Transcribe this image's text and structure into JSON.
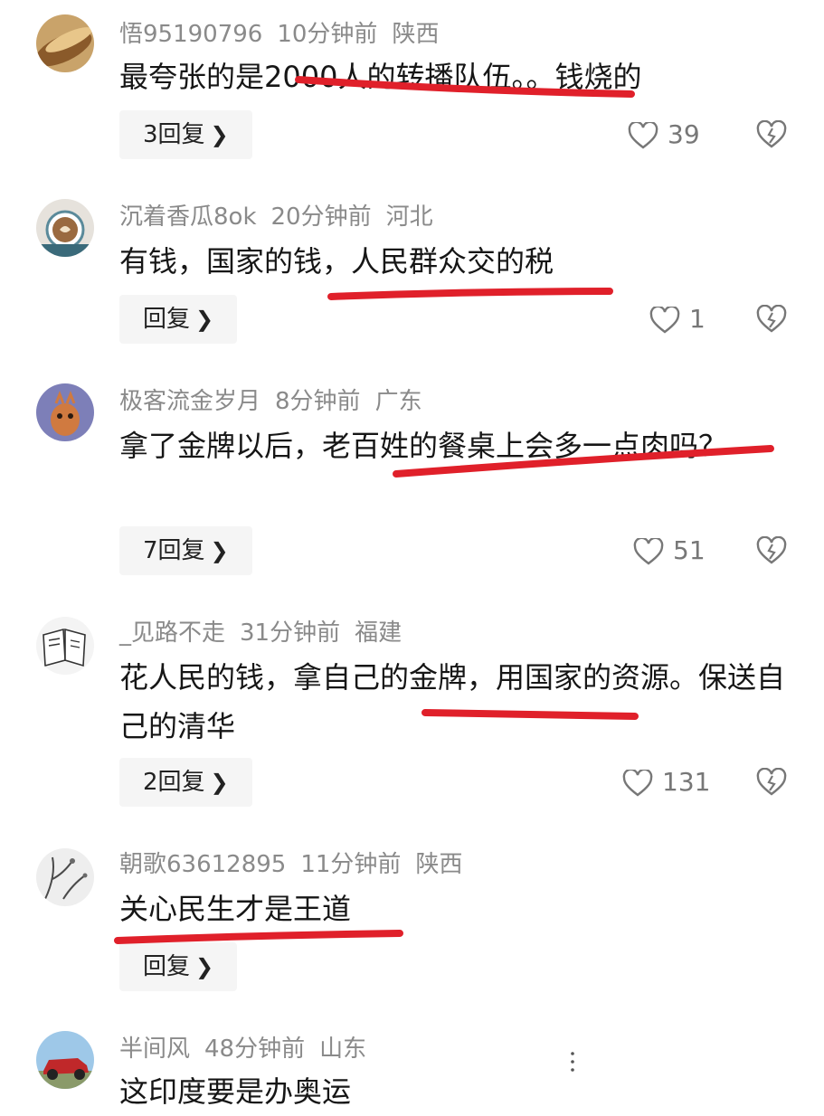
{
  "comments": [
    {
      "username": "悟95190796",
      "time": "10分钟前",
      "location": "陕西",
      "text": "最夸张的是2000人的转播队伍。。钱烧的",
      "reply_label": "3回复",
      "likes": "39"
    },
    {
      "username": "沉着香瓜8ok",
      "time": "20分钟前",
      "location": "河北",
      "text": "有钱，国家的钱，人民群众交的税",
      "reply_label": "回复",
      "likes": "1"
    },
    {
      "username": "极客流金岁月",
      "time": "8分钟前",
      "location": "广东",
      "text": "拿了金牌以后，老百姓的餐桌上会多一点肉吗？",
      "reply_label": "7回复",
      "likes": "51"
    },
    {
      "username": "_见路不走",
      "time": "31分钟前",
      "location": "福建",
      "text": "花人民的钱，拿自己的金牌，用国家的资源。保送自己的清华",
      "reply_label": "2回复",
      "likes": "131"
    },
    {
      "username": "朝歌63612895",
      "time": "11分钟前",
      "location": "陕西",
      "text": "关心民生才是王道",
      "reply_label": "回复",
      "likes": ""
    },
    {
      "username": "半间风",
      "time": "48分钟前",
      "location": "山东",
      "text": "这印度要是办奥运",
      "reply_label": "",
      "likes": ""
    }
  ],
  "icons": {
    "like": "heart-outline-icon",
    "dislike": "broken-heart-icon",
    "reply_chevron": "chevron-right-icon"
  },
  "colors": {
    "underline": "#e0202a",
    "meta_text": "#8a8a8a",
    "reply_bg": "#f5f5f5"
  }
}
